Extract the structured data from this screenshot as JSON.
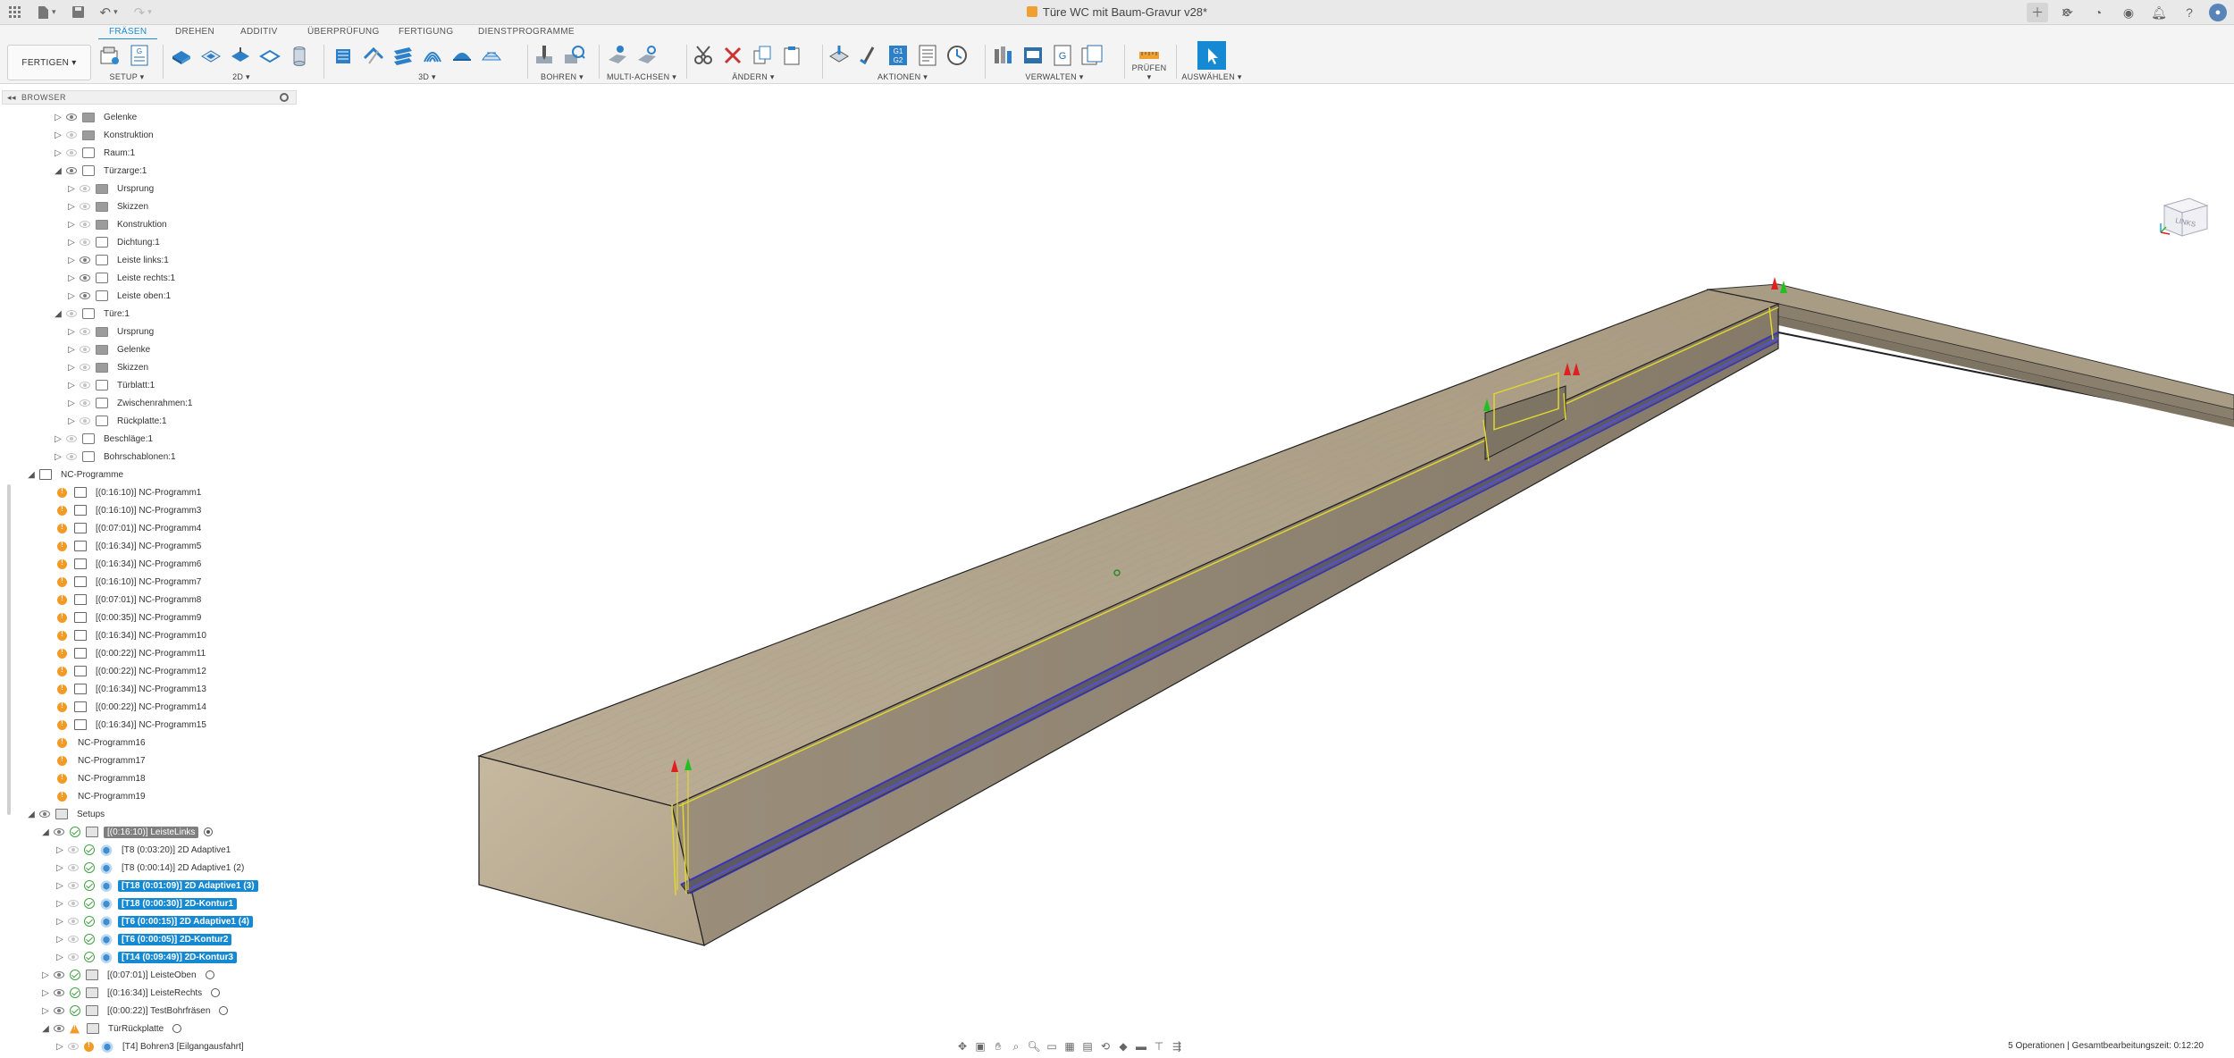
{
  "window": {
    "title": "Türe WC mit Baum-Gravur v28*"
  },
  "tabs": [
    {
      "label": "FRÄSEN",
      "active": true
    },
    {
      "label": "DREHEN"
    },
    {
      "label": "ADDITIV"
    },
    {
      "label": "ÜBERPRÜFUNG"
    },
    {
      "label": "FERTIGUNG"
    },
    {
      "label": "DIENSTPROGRAMME"
    }
  ],
  "toolbar": {
    "workspace": "FERTIGEN ▾",
    "groups": [
      {
        "label": "SETUP ▾"
      },
      {
        "label": "2D ▾"
      },
      {
        "label": "3D ▾"
      },
      {
        "label": "BOHREN ▾"
      },
      {
        "label": "MULTI-ACHSEN ▾"
      },
      {
        "label": "ÄNDERN ▾"
      },
      {
        "label": "AKTIONEN ▾"
      },
      {
        "label": "VERWALTEN ▾"
      },
      {
        "label": "PRÜFEN ▾"
      },
      {
        "label": "AUSWÄHLEN ▾"
      }
    ],
    "g1g2": "G1\nG2"
  },
  "browser": {
    "title": "BROWSER",
    "rows": [
      {
        "label": "Gelenke",
        "icon": "folder"
      },
      {
        "label": "Konstruktion",
        "icon": "folder"
      },
      {
        "label": "Raum:1",
        "icon": "comp"
      },
      {
        "label": "Türzarge:1",
        "icon": "comp"
      },
      {
        "label": "Ursprung",
        "icon": "folder"
      },
      {
        "label": "Skizzen",
        "icon": "folder"
      },
      {
        "label": "Konstruktion",
        "icon": "folder"
      },
      {
        "label": "Dichtung:1",
        "icon": "comp"
      },
      {
        "label": "Leiste links:1",
        "icon": "comp"
      },
      {
        "label": "Leiste rechts:1",
        "icon": "comp"
      },
      {
        "label": "Leiste oben:1",
        "icon": "comp"
      },
      {
        "label": "Türe:1",
        "icon": "comp"
      },
      {
        "label": "Ursprung",
        "icon": "folder"
      },
      {
        "label": "Gelenke",
        "icon": "folder"
      },
      {
        "label": "Skizzen",
        "icon": "folder"
      },
      {
        "label": "Türblatt:1",
        "icon": "comp"
      },
      {
        "label": "Zwischenrahmen:1",
        "icon": "comp"
      },
      {
        "label": "Rückplatte:1",
        "icon": "comp"
      },
      {
        "label": "Beschläge:1",
        "icon": "comp"
      },
      {
        "label": "Bohrschablonen:1",
        "icon": "comp"
      },
      {
        "label": "NC-Programme",
        "icon": "prog"
      },
      {
        "label": "[(0:16:10)] NC-Programm1"
      },
      {
        "label": "[(0:16:10)] NC-Programm3"
      },
      {
        "label": "[(0:07:01)] NC-Programm4"
      },
      {
        "label": "[(0:16:34)] NC-Programm5"
      },
      {
        "label": "[(0:16:34)] NC-Programm6"
      },
      {
        "label": "[(0:16:10)] NC-Programm7"
      },
      {
        "label": "[(0:07:01)] NC-Programm8"
      },
      {
        "label": "[(0:00:35)] NC-Programm9"
      },
      {
        "label": "[(0:16:34)] NC-Programm10"
      },
      {
        "label": "[(0:00:22)] NC-Programm11"
      },
      {
        "label": "[(0:00:22)] NC-Programm12"
      },
      {
        "label": "[(0:16:34)] NC-Programm13"
      },
      {
        "label": "[(0:00:22)] NC-Programm14"
      },
      {
        "label": "[(0:16:34)] NC-Programm15"
      },
      {
        "label": "NC-Programm16"
      },
      {
        "label": "NC-Programm17"
      },
      {
        "label": "NC-Programm18"
      },
      {
        "label": "NC-Programm19"
      },
      {
        "label": "Setups"
      },
      {
        "label": "[(0:16:10)] LeisteLinks"
      },
      {
        "label": "[T8 (0:03:20)] 2D Adaptive1"
      },
      {
        "label": "[T8 (0:00:14)] 2D Adaptive1 (2)"
      },
      {
        "label": "[T18 (0:01:09)] 2D Adaptive1 (3)"
      },
      {
        "label": "[T18 (0:00:30)] 2D-Kontur1"
      },
      {
        "label": "[T6 (0:00:15)] 2D Adaptive1 (4)"
      },
      {
        "label": "[T6 (0:00:05)] 2D-Kontur2"
      },
      {
        "label": "[T14 (0:09:49)] 2D-Kontur3"
      },
      {
        "label": "[(0:07:01)] LeisteOben"
      },
      {
        "label": "[(0:16:34)] LeisteRechts"
      },
      {
        "label": "[(0:00:22)] TestBohrfräsen"
      },
      {
        "label": "TürRückplatte"
      },
      {
        "label": "[T4] Bohren3 [Eilgangausfahrt]"
      }
    ]
  },
  "viewcube": {
    "label": "LINKS"
  },
  "status": {
    "text": "5 Operationen | Gesamtbearbeitungszeit: 0:12:20"
  },
  "colors": {
    "accent": "#1589d2",
    "warning": "#f29a26",
    "ok": "#46a046",
    "wood_top": "#b5a891",
    "wood_front": "#8e8372",
    "toolpath": "#4040c8",
    "stock_outline": "#e8e020"
  }
}
